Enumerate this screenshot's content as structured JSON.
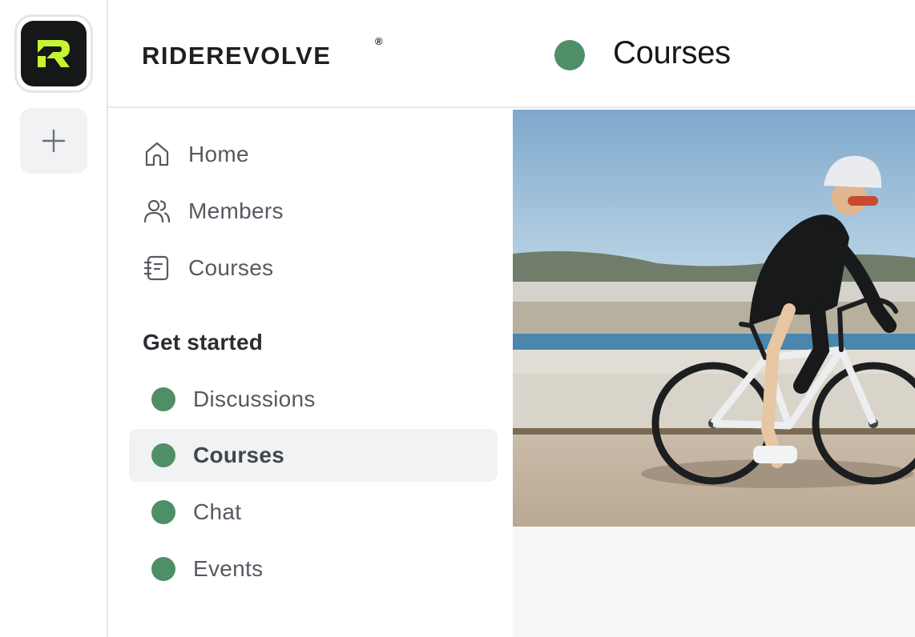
{
  "rail": {
    "app_icon": "riderevolve-logo-icon",
    "add_icon": "plus-icon"
  },
  "header": {
    "brand": "RIDEREVOLVE",
    "brand_mark": "®",
    "title": "Courses",
    "space_color": "#4e8f67"
  },
  "nav": {
    "items": [
      {
        "label": "Home",
        "icon": "home-icon"
      },
      {
        "label": "Members",
        "icon": "members-icon"
      },
      {
        "label": "Courses",
        "icon": "courses-icon"
      }
    ],
    "section_title": "Get started",
    "spaces": [
      {
        "label": "Discussions",
        "active": false
      },
      {
        "label": "Courses",
        "active": true
      },
      {
        "label": "Chat",
        "active": false
      },
      {
        "label": "Events",
        "active": false
      }
    ]
  },
  "colors": {
    "accent_green": "#4e8f67",
    "logo_lime": "#c6f432",
    "active_bg": "#f1f2f4"
  }
}
